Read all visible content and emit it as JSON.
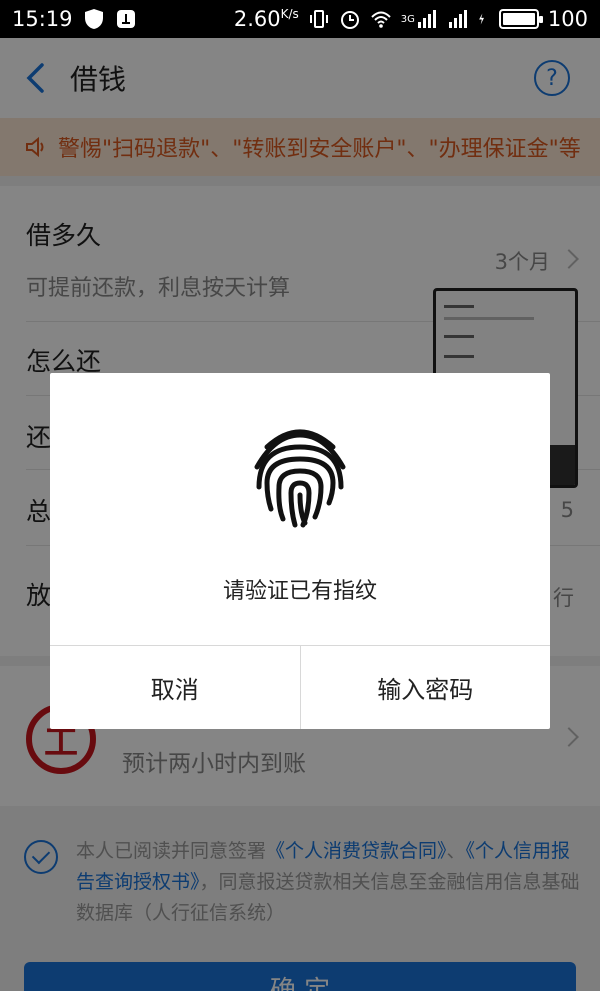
{
  "status_bar": {
    "time": "15:19",
    "speed": "2.60",
    "speed_unit": "K/s",
    "network": "3G",
    "battery": "100",
    "icons": [
      "shield-icon",
      "notification-icon",
      "vibrate-icon",
      "alarm-icon",
      "wifi-icon",
      "signal-icon",
      "charging-icon",
      "battery-icon"
    ]
  },
  "header": {
    "title": "借钱",
    "help_label": "?"
  },
  "notice": {
    "text": "警惕\"扫码退款\"、\"转账到安全账户\"、\"办理保证金\"等"
  },
  "form": {
    "duration_label": "借多久",
    "duration_hint": "可提前还款，利息按天计算",
    "duration_value": "3个月",
    "repay_label": "怎么还",
    "row3_label": "还",
    "row4_label": "总",
    "row4_value": "5",
    "row5_label": "放",
    "row5_value": "行"
  },
  "bank": {
    "logo_text": "工",
    "eta": "预计两小时内到账"
  },
  "agreement": {
    "prefix": "本人已阅读并同意签署",
    "link1": "《个人消费贷款合同》",
    "sep": "、",
    "link2": "《个人信用报告查询授权书》",
    "suffix": "，同意报送贷款相关信息至金融信用信息基础数据库（人行征信系统）"
  },
  "submit": {
    "label": "确 定"
  },
  "dialog": {
    "message": "请验证已有指纹",
    "cancel_label": "取消",
    "password_label": "输入密码"
  },
  "colors": {
    "accent": "#1a73d9",
    "notice_bg": "#fbe6d3",
    "notice_text": "#d9581f",
    "bank_red": "#c8161d"
  }
}
